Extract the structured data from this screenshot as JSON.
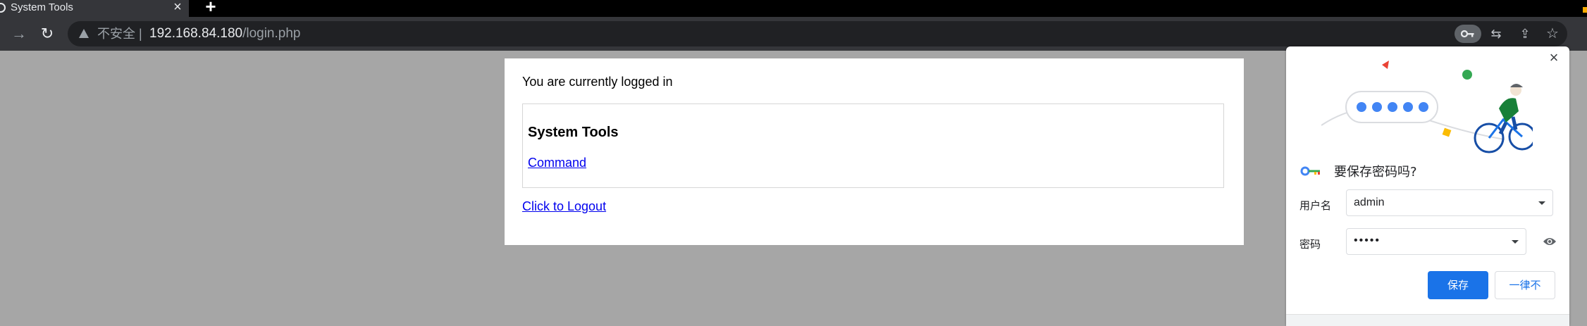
{
  "browser": {
    "tab_title": "System Tools",
    "tab_close_icon": "×",
    "new_tab_icon": "+",
    "security_label": "不安全",
    "url_host": "192.168.84.180",
    "url_path": "/login.php"
  },
  "page": {
    "status_text": "You are currently logged in",
    "section_title": "System Tools",
    "command_link": "Command",
    "logout_link": "Click to Logout"
  },
  "password_bubble": {
    "title": "要保存密码吗?",
    "username_label": "用户名",
    "username_value": "admin",
    "password_label": "密码",
    "password_value": "•••••",
    "save_button": "保存",
    "never_button": "一律不",
    "close_icon": "×"
  },
  "colors": {
    "page_background": "#a6a6a6",
    "link": "#0000ee",
    "accent_blue": "#1a73e8",
    "browser_chrome": "#35363a"
  }
}
